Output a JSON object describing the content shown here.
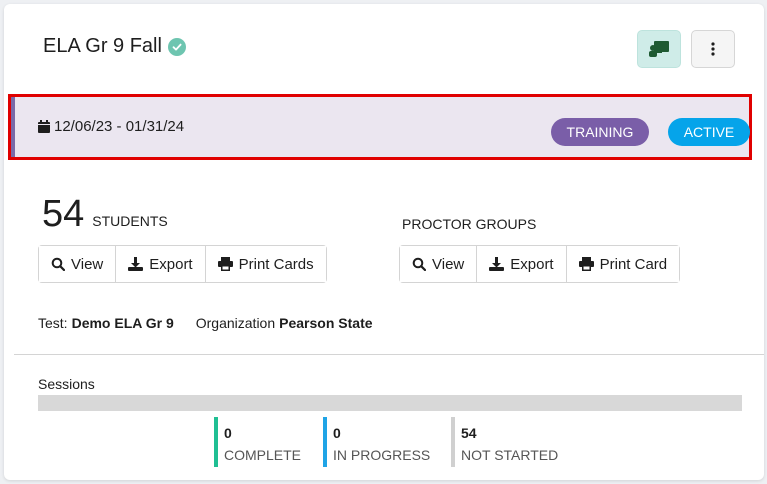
{
  "session": {
    "title": "ELA Gr 9 Fall",
    "date_range": "12/06/23 - 01/31/24",
    "badges": {
      "training": "TRAINING",
      "active": "ACTIVE"
    }
  },
  "students": {
    "count": "54",
    "label": "STUDENTS",
    "buttons": {
      "view": "View",
      "export": "Export",
      "print": "Print Cards"
    }
  },
  "proctor_groups": {
    "label": "PROCTOR GROUPS",
    "buttons": {
      "view": "View",
      "export": "Export",
      "print": "Print Card"
    }
  },
  "meta": {
    "test_label": "Test:",
    "test_value": "Demo ELA Gr 9",
    "org_label": "Organization",
    "org_value": "Pearson State"
  },
  "sessions": {
    "title": "Sessions",
    "stats": [
      {
        "value": "0",
        "label": "COMPLETE"
      },
      {
        "value": "0",
        "label": "IN PROGRESS"
      },
      {
        "value": "54",
        "label": "NOT STARTED"
      }
    ]
  },
  "colors": {
    "training": "#7a5ea8",
    "active": "#05a4ea",
    "complete": "#1fbf93",
    "in_progress": "#1fa4e6",
    "not_started": "#d0d0d0",
    "highlight": "#e00000"
  }
}
